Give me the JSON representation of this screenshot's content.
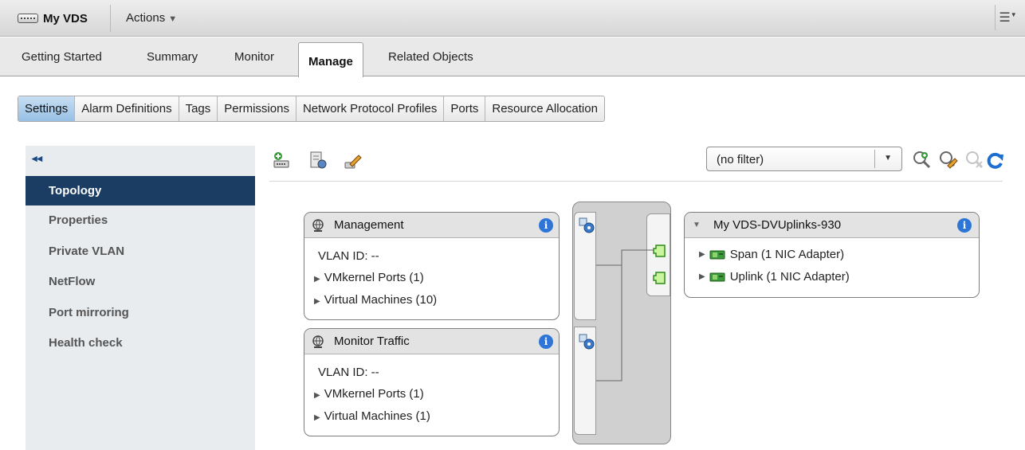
{
  "header": {
    "title": "My VDS",
    "actions_label": "Actions",
    "menu_icon": "list-menu-icon"
  },
  "main_tabs": [
    {
      "label": "Getting Started",
      "active": false
    },
    {
      "label": "Summary",
      "active": false
    },
    {
      "label": "Monitor",
      "active": false
    },
    {
      "label": "Manage",
      "active": true
    },
    {
      "label": "Related Objects",
      "active": false
    }
  ],
  "sub_tabs": [
    {
      "label": "Settings",
      "active": true
    },
    {
      "label": "Alarm Definitions",
      "active": false
    },
    {
      "label": "Tags",
      "active": false
    },
    {
      "label": "Permissions",
      "active": false
    },
    {
      "label": "Network Protocol Profiles",
      "active": false
    },
    {
      "label": "Ports",
      "active": false
    },
    {
      "label": "Resource Allocation",
      "active": false
    }
  ],
  "sidebar": {
    "collapse_icon": "double-chevron-left-icon",
    "items": [
      {
        "label": "Topology",
        "active": true
      },
      {
        "label": "Properties",
        "active": false
      },
      {
        "label": "Private VLAN",
        "active": false
      },
      {
        "label": "NetFlow",
        "active": false
      },
      {
        "label": "Port mirroring",
        "active": false
      },
      {
        "label": "Health check",
        "active": false
      }
    ]
  },
  "toolbar": {
    "left_icons": [
      "add-host-icon",
      "manage-hosts-icon",
      "edit-settings-icon"
    ],
    "filter_value": "(no filter)",
    "right_icons": [
      "zoom-in-icon",
      "edit-filter-icon",
      "clear-filter-icon",
      "refresh-icon"
    ]
  },
  "topology": {
    "port_groups": [
      {
        "name": "Management",
        "vlan": "VLAN ID: --",
        "vmkernel": "VMkernel Ports (1)",
        "vms": "Virtual Machines (10)"
      },
      {
        "name": "Monitor Traffic",
        "vlan": "VLAN ID: --",
        "vmkernel": "VMkernel Ports (1)",
        "vms": "Virtual Machines (1)"
      }
    ],
    "uplink_group": {
      "name": "My VDS-DVUplinks-930",
      "items": [
        "Span (1 NIC Adapter)",
        "Uplink (1 NIC Adapter)"
      ]
    }
  },
  "colors": {
    "active_nav": "#1c3d63",
    "active_subtab": "#97c0e4",
    "info_icon": "#2d75d6",
    "nic_green": "#3d9a3a",
    "refresh_blue": "#1c6fd1"
  }
}
